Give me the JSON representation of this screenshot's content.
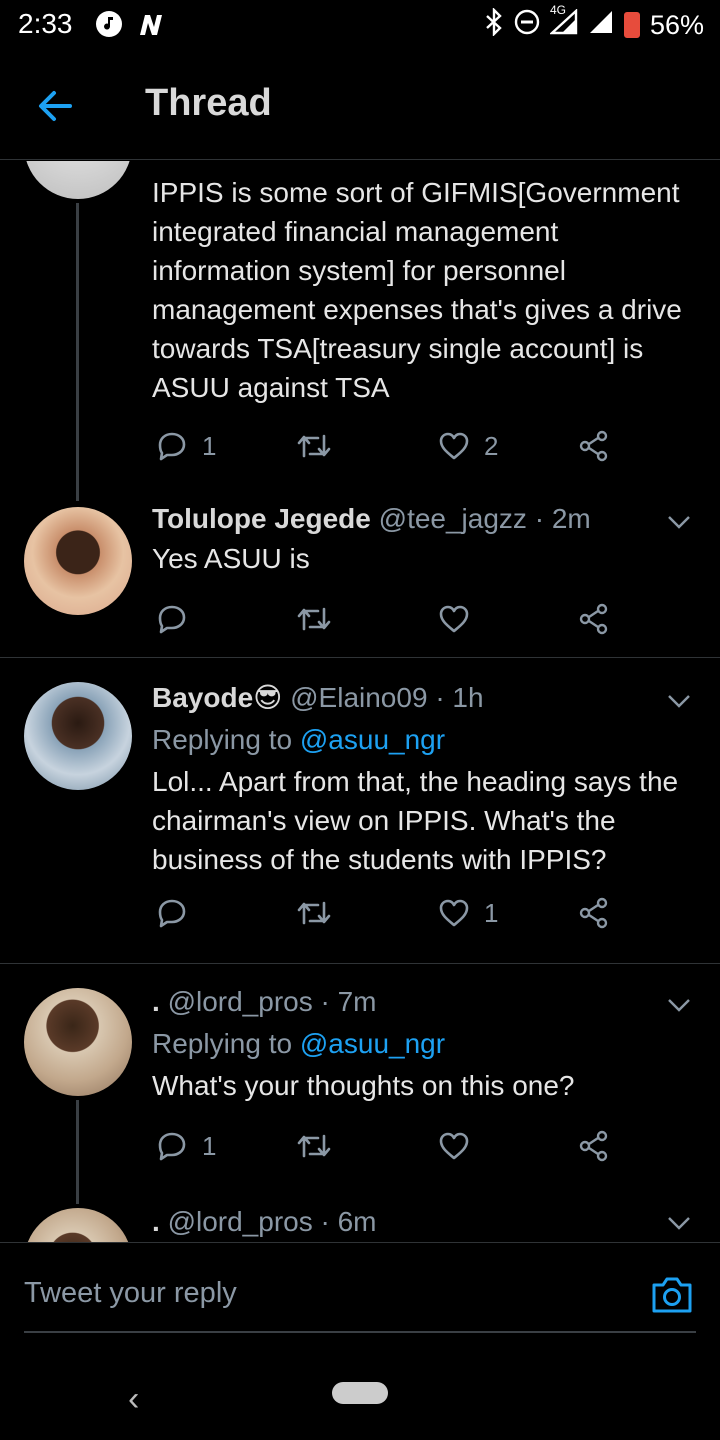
{
  "status": {
    "time": "2:33",
    "network": "4G",
    "battery": "56%"
  },
  "appbar": {
    "title": "Thread"
  },
  "tweets": [
    {
      "text": "IPPIS is some sort of GIFMIS[Government integrated financial management information system] for personnel management expenses that's gives a drive towards TSA[treasury single account] is ASUU against TSA",
      "replies": "1",
      "retweets": "",
      "likes": "2"
    },
    {
      "name": "Tolulope Jegede",
      "handle": "@tee_jagzz",
      "time": "· 2m",
      "text": "Yes ASUU is",
      "replies": "",
      "retweets": "",
      "likes": ""
    },
    {
      "name": "Bayode😎",
      "handle": "@Elaino09",
      "time": "· 1h",
      "replying_prefix": "Replying to ",
      "replying_to": "@asuu_ngr",
      "text": "Lol... Apart from that, the heading says the chairman's view on IPPIS. What's the business of the students with IPPIS?",
      "replies": "",
      "retweets": "",
      "likes": "1"
    },
    {
      "name": ".",
      "handle": "@lord_pros",
      "time": "· 7m",
      "replying_prefix": "Replying to ",
      "replying_to": "@asuu_ngr",
      "text": "What's your thoughts on this one?",
      "replies": "1",
      "retweets": "",
      "likes": ""
    },
    {
      "name": ".",
      "handle": "@lord_pros",
      "time": "· 6m"
    }
  ],
  "composer": {
    "placeholder": "Tweet your reply"
  },
  "colors": {
    "accent": "#1da1f2",
    "muted": "#8b98a5",
    "background": "#000000"
  }
}
